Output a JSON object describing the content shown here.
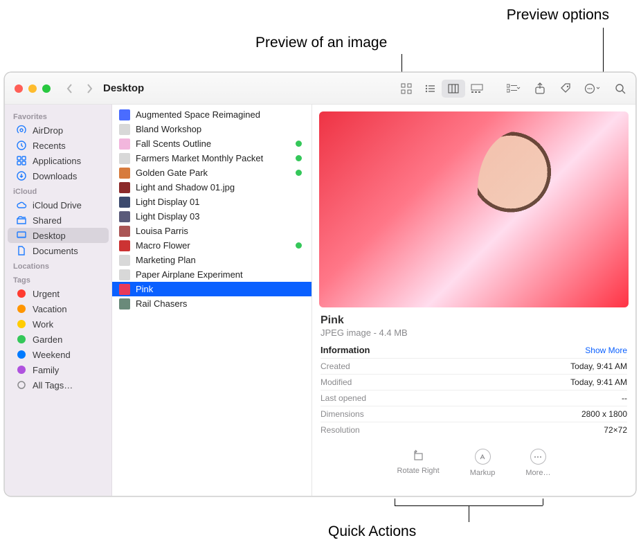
{
  "callouts": {
    "preview_options": "Preview options",
    "preview_image": "Preview of an image",
    "quick_actions": "Quick Actions"
  },
  "window": {
    "title": "Desktop"
  },
  "sidebar": {
    "sections": [
      {
        "header": "Favorites",
        "items": [
          {
            "icon": "airdrop",
            "label": "AirDrop"
          },
          {
            "icon": "recents",
            "label": "Recents"
          },
          {
            "icon": "apps",
            "label": "Applications"
          },
          {
            "icon": "downloads",
            "label": "Downloads"
          }
        ]
      },
      {
        "header": "iCloud",
        "items": [
          {
            "icon": "cloud",
            "label": "iCloud Drive"
          },
          {
            "icon": "shared",
            "label": "Shared"
          },
          {
            "icon": "desktop",
            "label": "Desktop",
            "selected": true
          },
          {
            "icon": "docs",
            "label": "Documents"
          }
        ]
      },
      {
        "header": "Locations",
        "items": []
      },
      {
        "header": "Tags",
        "items": [
          {
            "color": "#ff3b30",
            "label": "Urgent"
          },
          {
            "color": "#ff9500",
            "label": "Vacation"
          },
          {
            "color": "#ffcc00",
            "label": "Work"
          },
          {
            "color": "#34c759",
            "label": "Garden"
          },
          {
            "color": "#007aff",
            "label": "Weekend"
          },
          {
            "color": "#af52de",
            "label": "Family"
          },
          {
            "icon": "alltags",
            "label": "All Tags…"
          }
        ]
      }
    ]
  },
  "files": [
    {
      "name": "Augmented Space Reimagined",
      "color": "#4a6cff"
    },
    {
      "name": "Bland Workshop",
      "color": "#d8d8d8"
    },
    {
      "name": "Fall Scents Outline",
      "color": "#f2b6dd",
      "tag": true
    },
    {
      "name": "Farmers Market Monthly Packet",
      "color": "#d8d8d8",
      "tag": true
    },
    {
      "name": "Golden Gate Park",
      "color": "#d77b3d",
      "tag": true
    },
    {
      "name": "Light and Shadow 01.jpg",
      "color": "#8b2a2a"
    },
    {
      "name": "Light Display 01",
      "color": "#3c4a6e"
    },
    {
      "name": "Light Display 03",
      "color": "#5a5a7a"
    },
    {
      "name": "Louisa Parris",
      "color": "#a55"
    },
    {
      "name": "Macro Flower",
      "color": "#c33",
      "tag": true
    },
    {
      "name": "Marketing Plan",
      "color": "#d8d8d8"
    },
    {
      "name": "Paper Airplane Experiment",
      "color": "#d8d8d8"
    },
    {
      "name": "Pink",
      "color": "#e83a5a",
      "selected": true
    },
    {
      "name": "Rail Chasers",
      "color": "#6a8a7a"
    }
  ],
  "preview": {
    "name": "Pink",
    "subtitle": "JPEG image - 4.4 MB",
    "info_label": "Information",
    "show_more": "Show More",
    "rows": [
      {
        "key": "Created",
        "value": "Today, 9:41 AM"
      },
      {
        "key": "Modified",
        "value": "Today, 9:41 AM"
      },
      {
        "key": "Last opened",
        "value": "--"
      },
      {
        "key": "Dimensions",
        "value": "2800 x 1800"
      },
      {
        "key": "Resolution",
        "value": "72×72"
      }
    ],
    "actions": {
      "rotate": "Rotate Right",
      "markup": "Markup",
      "more": "More…"
    }
  }
}
